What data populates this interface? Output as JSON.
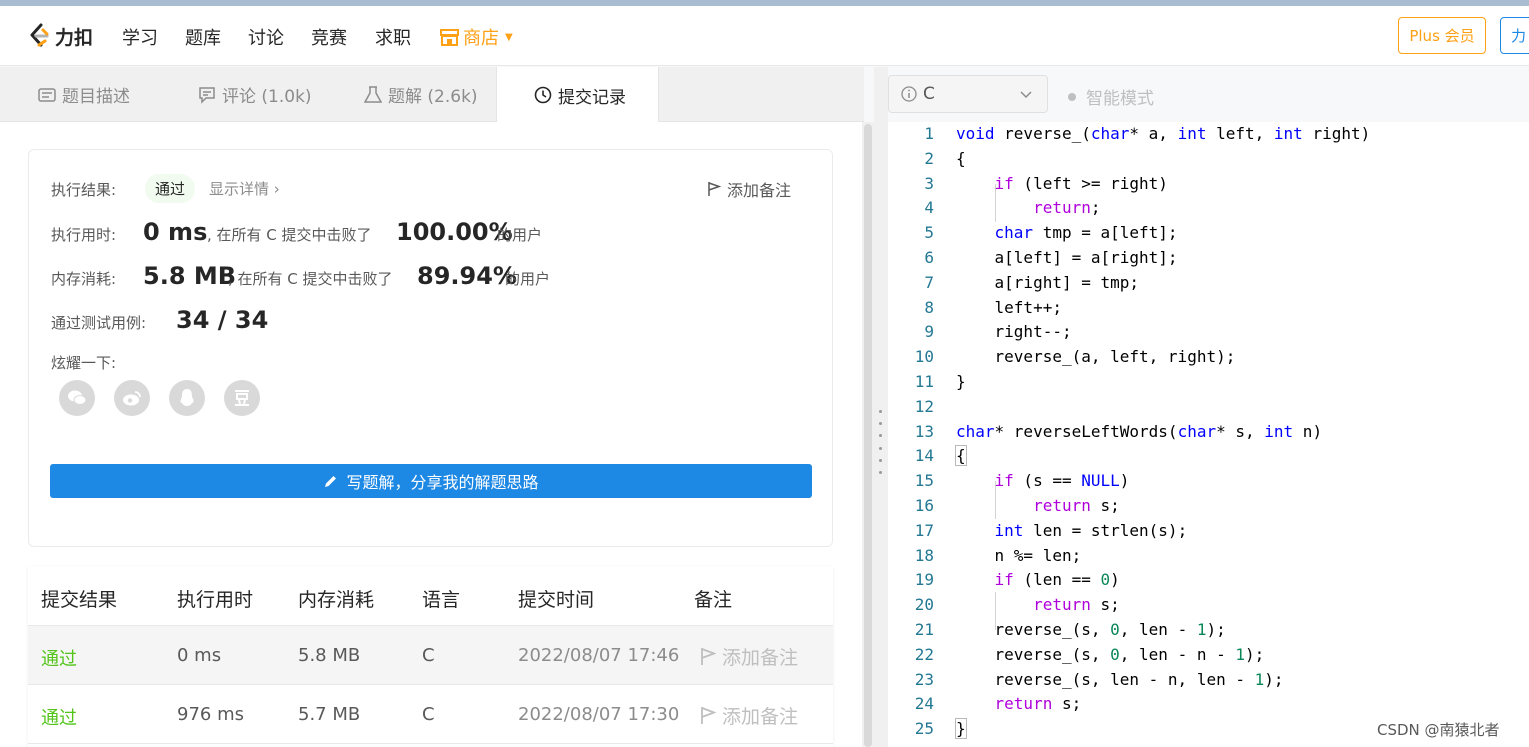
{
  "nav": {
    "logo_text": "力扣",
    "items": [
      "学习",
      "题库",
      "讨论",
      "竞赛",
      "求职"
    ],
    "shop": "商店",
    "plus": "Plus 会员",
    "lk": "力"
  },
  "tabs": [
    {
      "label": "题目描述",
      "icon": "document-icon"
    },
    {
      "label": "评论 (1.0k)",
      "icon": "comment-icon"
    },
    {
      "label": "题解 (2.6k)",
      "icon": "flask-icon"
    },
    {
      "label": "提交记录",
      "icon": "clock-icon"
    }
  ],
  "result": {
    "label_result": "执行结果:",
    "status": "通过",
    "show_detail": "显示详情",
    "add_note": "添加备注",
    "label_time": "执行用时:",
    "time_value": "0 ms",
    "time_text": ", 在所有 C 提交中击败了",
    "time_pct": "100.00%",
    "users_text": "的用户",
    "label_mem": "内存消耗:",
    "mem_value": "5.8 MB",
    "mem_text": ", 在所有 C 提交中击败了",
    "mem_pct": "89.94%",
    "label_cases": "通过测试用例:",
    "cases_value": "34 / 34",
    "label_share": "炫耀一下:",
    "share_icons": [
      "wechat-icon",
      "weibo-icon",
      "qq-icon",
      "douban-icon"
    ],
    "write_btn": "写题解，分享我的解题思路"
  },
  "table": {
    "headers": [
      "提交结果",
      "执行用时",
      "内存消耗",
      "语言",
      "提交时间",
      "备注"
    ],
    "rows": [
      {
        "result": "通过",
        "time": "0 ms",
        "mem": "5.8 MB",
        "lang": "C",
        "submitted": "2022/08/07 17:46",
        "note": "添加备注"
      },
      {
        "result": "通过",
        "time": "976 ms",
        "mem": "5.7 MB",
        "lang": "C",
        "submitted": "2022/08/07 17:30",
        "note": "添加备注"
      }
    ]
  },
  "editor": {
    "language": "C",
    "smart_mode": "智能模式",
    "line_numbers": [
      "1",
      "2",
      "3",
      "4",
      "5",
      "6",
      "7",
      "8",
      "9",
      "10",
      "11",
      "12",
      "13",
      "14",
      "15",
      "16",
      "17",
      "18",
      "19",
      "20",
      "21",
      "22",
      "23",
      "24",
      "25"
    ]
  },
  "watermark": "CSDN @南猿北者",
  "colors": {
    "accent": "#ffa116",
    "primary": "#1e88e5",
    "pass": "#52c41a"
  }
}
